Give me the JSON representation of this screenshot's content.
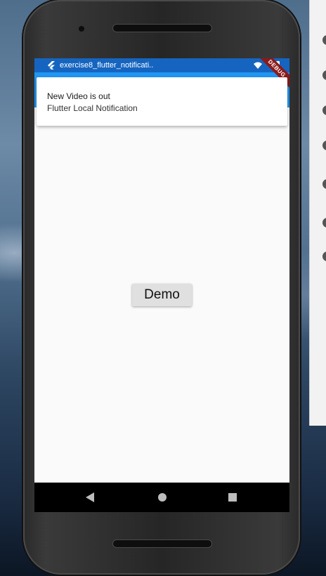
{
  "status_bar": {
    "app_name": "exercise8_flutter_notificati..",
    "icons": [
      "flutter-icon",
      "wifi-icon",
      "battery-icon"
    ]
  },
  "debug_banner": "DEBUG",
  "notification": {
    "title": "New Video is out",
    "body": "Flutter Local Notification"
  },
  "main": {
    "demo_button_label": "Demo"
  },
  "nav_bar": {
    "buttons": [
      "back",
      "home",
      "recents"
    ]
  },
  "colors": {
    "status_bar": "#1565c0",
    "app_bar": "#2196f3",
    "screen_bg": "#fafafa",
    "button_bg": "#e0e0e0"
  }
}
